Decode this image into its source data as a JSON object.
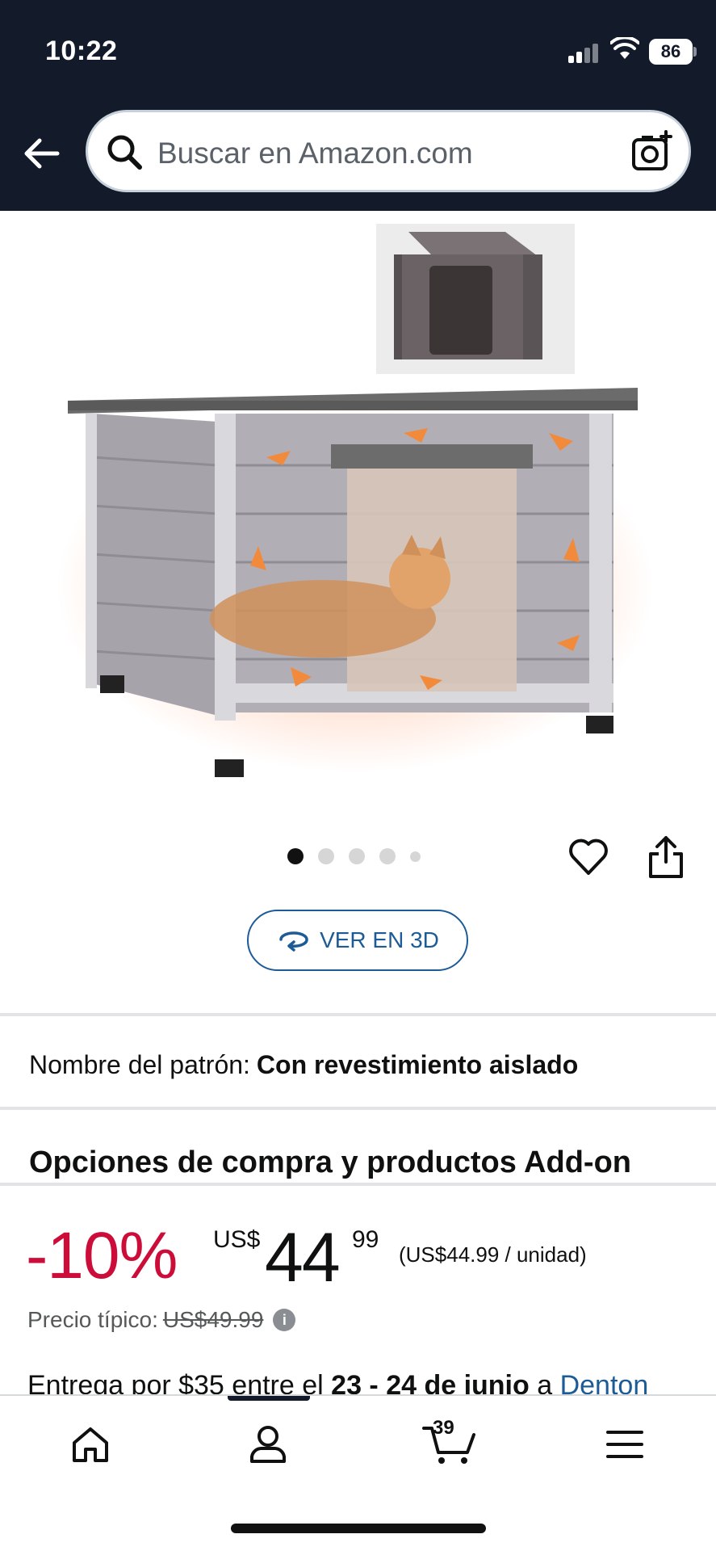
{
  "status_bar": {
    "time": "10:22",
    "battery": "86"
  },
  "header": {
    "search_placeholder": "Buscar en Amazon.com"
  },
  "gallery": {
    "dot_count": 5,
    "active_index": 0
  },
  "view_3d": {
    "label": "VER EN 3D"
  },
  "pattern": {
    "label": "Nombre del patrón:",
    "value": "Con revestimiento aislado"
  },
  "buy_options": {
    "title": "Opciones de compra y productos Add-on"
  },
  "price": {
    "discount": "-10%",
    "currency": "US$",
    "whole": "44",
    "cents": "99",
    "unit_price": "(US$44.99 / unidad)",
    "typical_label": "Precio típico:",
    "typical_value": "US$49.99"
  },
  "delivery": {
    "prefix": "Entrega por $35 entre el ",
    "dates": "23 - 24 de junio",
    "middle": " a ",
    "location": "Denton"
  },
  "bottom_nav": {
    "cart_count": "39"
  },
  "colors": {
    "header_bg": "#131a2a",
    "discount_red": "#cc0c39",
    "link_blue": "#1d5b97"
  }
}
